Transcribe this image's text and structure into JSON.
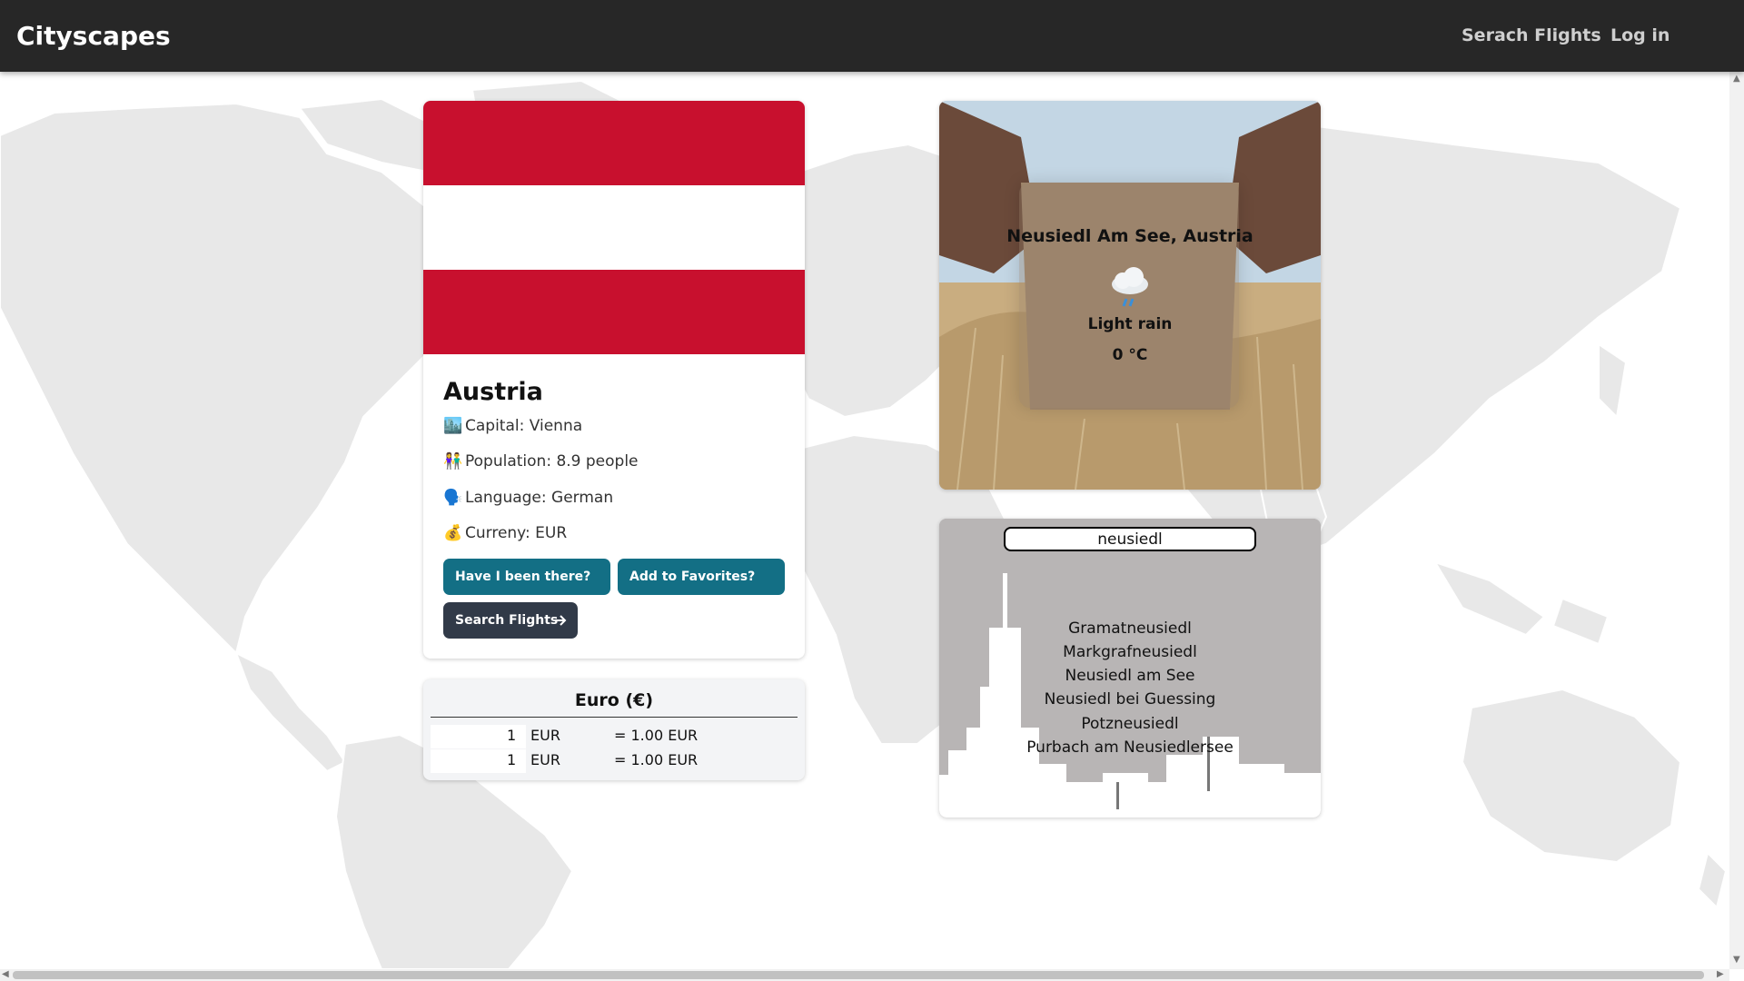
{
  "navbar": {
    "brand": "Cityscapes",
    "links": [
      "Serach Flights",
      "Log in"
    ]
  },
  "country": {
    "name": "Austria",
    "flag_colors": [
      "#c8102e",
      "#ffffff",
      "#c8102e"
    ],
    "info": [
      {
        "icon": "🏙️",
        "icon_name": "cityscape-icon",
        "text": "Capital: Vienna"
      },
      {
        "icon": "👫",
        "icon_name": "people-icon",
        "text": "Population: 8.9 people"
      },
      {
        "icon": "🗣️",
        "icon_name": "speaking-head-icon",
        "text": "Language: German"
      },
      {
        "icon": "💰",
        "icon_name": "money-bag-icon",
        "text": "Curreny: EUR"
      }
    ],
    "buttons": {
      "been_there": "Have I been there?",
      "favorites": "Add to Favorites?",
      "search_flights": "Search Flights"
    },
    "accent_color": "#136f85"
  },
  "currency": {
    "title": "Euro (€)",
    "rows": [
      {
        "amount": "1",
        "code": "EUR",
        "result": "= 1.00 EUR"
      },
      {
        "amount": "1",
        "code": "EUR",
        "result": "= 1.00 EUR"
      }
    ]
  },
  "weather": {
    "location": "Neusiedl Am See, Austria",
    "icon_name": "rain-cloud-icon",
    "description": "Light rain",
    "temperature": "0 °C"
  },
  "search": {
    "value": "neusiedl",
    "results": [
      "Gramatneusiedl",
      "Markgrafneusiedl",
      "Neusiedl am See",
      "Neusiedl bei Guessing",
      "Potzneusiedl",
      "Purbach am Neusiedlersee"
    ]
  }
}
